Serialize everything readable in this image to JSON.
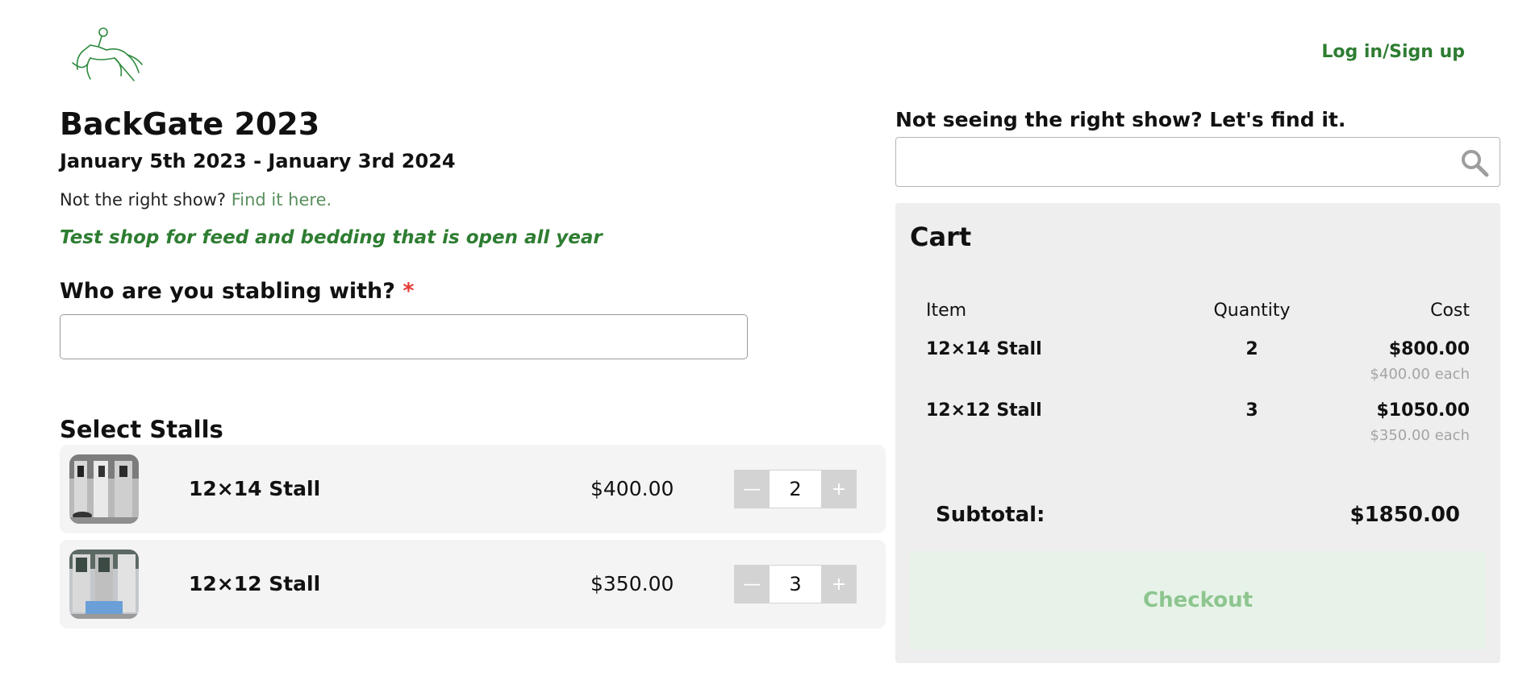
{
  "header": {
    "login_label": "Log in/Sign up"
  },
  "show": {
    "title": "BackGate 2023",
    "dates": "January 5th 2023 - January 3rd 2024",
    "not_right_prefix": "Not the right show?",
    "find_link": "Find it here.",
    "description": "Test shop for feed and bedding that is open all year"
  },
  "stabling": {
    "label": "Who are you stabling with?",
    "required_mark": "*",
    "value": ""
  },
  "stalls": {
    "title": "Select Stalls",
    "items": [
      {
        "name": "12×14 Stall",
        "price": "$400.00",
        "quantity": "2",
        "minus": "—",
        "plus": "+"
      },
      {
        "name": "12×12 Stall",
        "price": "$350.00",
        "quantity": "3",
        "minus": "—",
        "plus": "+"
      }
    ]
  },
  "search": {
    "label": "Not seeing the right show? Let's find it.",
    "value": ""
  },
  "cart": {
    "title": "Cart",
    "headers": {
      "item": "Item",
      "quantity": "Quantity",
      "cost": "Cost"
    },
    "lines": [
      {
        "item": "12×14 Stall",
        "quantity": "2",
        "cost": "$800.00",
        "each": "$400.00 each"
      },
      {
        "item": "12×12 Stall",
        "quantity": "3",
        "cost": "$1050.00",
        "each": "$350.00 each"
      }
    ],
    "subtotal_label": "Subtotal:",
    "subtotal_value": "$1850.00",
    "checkout_label": "Checkout"
  },
  "colors": {
    "brand_green": "#2e7d32",
    "required_red": "#e53935",
    "checkout_bg": "#e7f3e8",
    "checkout_text": "#8dc58f"
  }
}
